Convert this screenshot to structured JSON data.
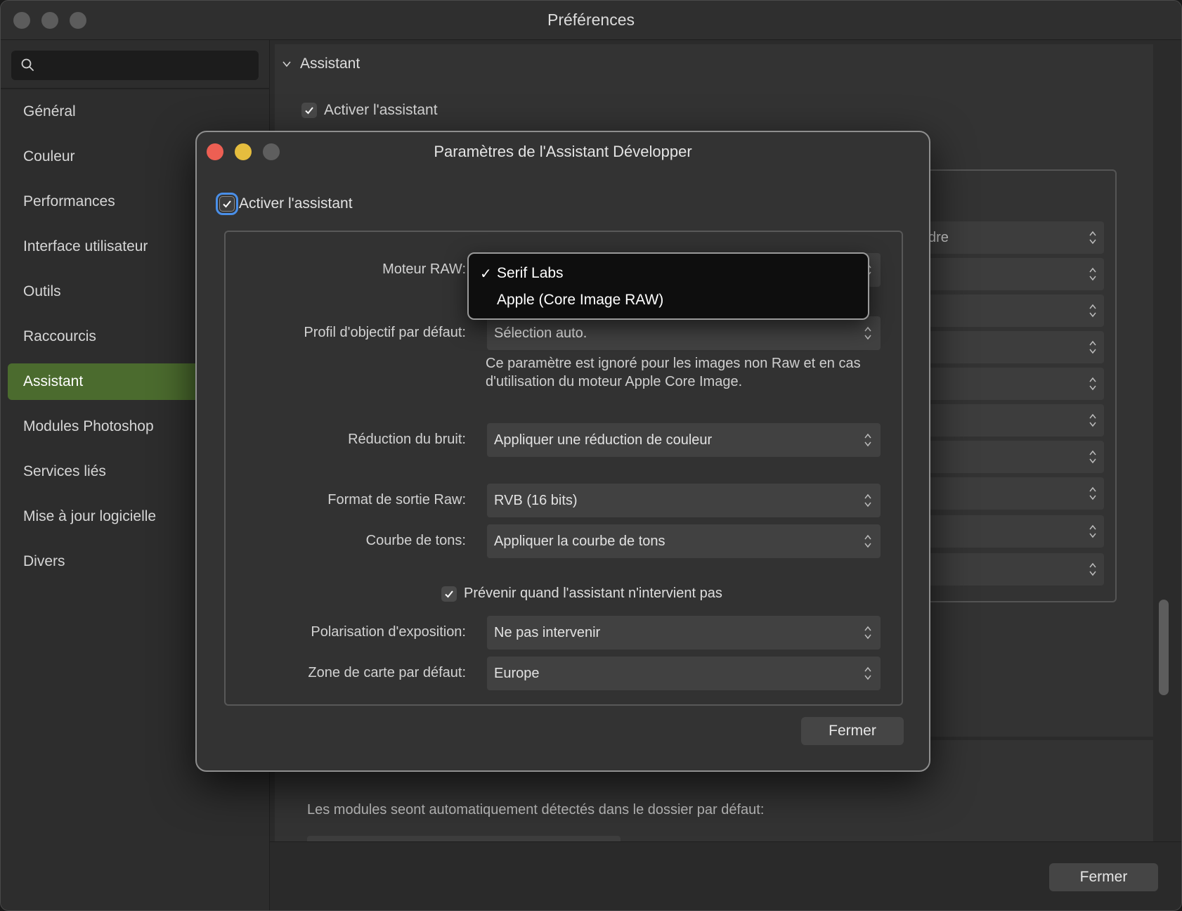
{
  "window": {
    "title": "Préférences",
    "close_label": "Fermer"
  },
  "sidebar": {
    "search": {
      "placeholder": "",
      "value": ""
    },
    "items": [
      {
        "label": "Général"
      },
      {
        "label": "Couleur"
      },
      {
        "label": "Performances"
      },
      {
        "label": "Interface utilisateur"
      },
      {
        "label": "Outils"
      },
      {
        "label": "Raccourcis"
      },
      {
        "label": "Assistant",
        "active": true
      },
      {
        "label": "Modules Photoshop"
      },
      {
        "label": "Services liés"
      },
      {
        "label": "Mise à jour logicielle"
      },
      {
        "label": "Divers"
      }
    ]
  },
  "content": {
    "section_title": "Assistant",
    "enable_label": "Activer l'assistant",
    "partial_select_text": "dre",
    "plugins_text": "Les modules seont automatiquement détectés dans le dossier par défaut:"
  },
  "dialog": {
    "title": "Paramètres de l'Assistant Développer",
    "enable_label": "Activer l'assistant",
    "raw_engine": {
      "label": "Moteur RAW:",
      "options": [
        "Serif Labs",
        "Apple (Core Image RAW)"
      ],
      "selected": "Serif Labs"
    },
    "lens_profile": {
      "label": "Profil d'objectif par défaut:",
      "value": "Sélection auto."
    },
    "hint": "Ce paramètre est ignoré pour les images non Raw et en cas d'utilisation du moteur Apple Core Image.",
    "noise": {
      "label": "Réduction du bruit:",
      "value": "Appliquer une réduction de couleur"
    },
    "raw_output": {
      "label": "Format de sortie Raw:",
      "value": "RVB (16 bits)"
    },
    "tone_curve": {
      "label": "Courbe de tons:",
      "value": "Appliquer la courbe de tons"
    },
    "warn_label": "Prévenir quand l'assistant n'intervient pas",
    "exposure_bias": {
      "label": "Polarisation d'exposition:",
      "value": "Ne pas intervenir"
    },
    "map_zone": {
      "label": "Zone de carte par défaut:",
      "value": "Europe"
    },
    "close_label": "Fermer"
  },
  "colors": {
    "accent_active": "#4b6b2e",
    "focus_ring": "#4a8fe8",
    "close_red": "#ed5f53",
    "minimize_yellow": "#e5bd3e"
  }
}
